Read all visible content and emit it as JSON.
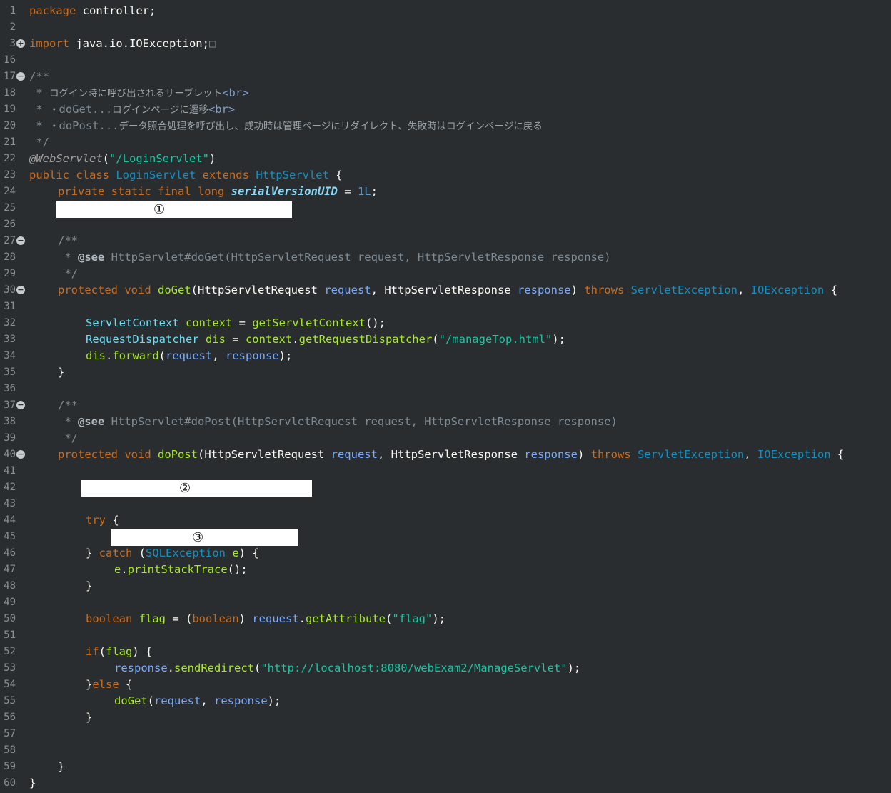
{
  "editor": {
    "language": "java",
    "lines": [
      {
        "n": "1",
        "fold": ""
      },
      {
        "n": "2",
        "fold": ""
      },
      {
        "n": "3",
        "fold": "+"
      },
      {
        "n": "16",
        "fold": ""
      },
      {
        "n": "17",
        "fold": "-"
      },
      {
        "n": "18",
        "fold": ""
      },
      {
        "n": "19",
        "fold": ""
      },
      {
        "n": "20",
        "fold": ""
      },
      {
        "n": "21",
        "fold": ""
      },
      {
        "n": "22",
        "fold": ""
      },
      {
        "n": "23",
        "fold": ""
      },
      {
        "n": "24",
        "fold": ""
      },
      {
        "n": "25",
        "fold": ""
      },
      {
        "n": "26",
        "fold": ""
      },
      {
        "n": "27",
        "fold": "-"
      },
      {
        "n": "28",
        "fold": ""
      },
      {
        "n": "29",
        "fold": ""
      },
      {
        "n": "30",
        "fold": "-"
      },
      {
        "n": "31",
        "fold": ""
      },
      {
        "n": "32",
        "fold": ""
      },
      {
        "n": "33",
        "fold": ""
      },
      {
        "n": "34",
        "fold": ""
      },
      {
        "n": "35",
        "fold": ""
      },
      {
        "n": "36",
        "fold": ""
      },
      {
        "n": "37",
        "fold": "-"
      },
      {
        "n": "38",
        "fold": ""
      },
      {
        "n": "39",
        "fold": ""
      },
      {
        "n": "40",
        "fold": "-"
      },
      {
        "n": "41",
        "fold": ""
      },
      {
        "n": "42",
        "fold": ""
      },
      {
        "n": "43",
        "fold": ""
      },
      {
        "n": "44",
        "fold": ""
      },
      {
        "n": "45",
        "fold": ""
      },
      {
        "n": "46",
        "fold": ""
      },
      {
        "n": "47",
        "fold": ""
      },
      {
        "n": "48",
        "fold": ""
      },
      {
        "n": "49",
        "fold": ""
      },
      {
        "n": "50",
        "fold": ""
      },
      {
        "n": "51",
        "fold": ""
      },
      {
        "n": "52",
        "fold": ""
      },
      {
        "n": "53",
        "fold": ""
      },
      {
        "n": "54",
        "fold": ""
      },
      {
        "n": "55",
        "fold": ""
      },
      {
        "n": "56",
        "fold": ""
      },
      {
        "n": "57",
        "fold": ""
      },
      {
        "n": "58",
        "fold": ""
      },
      {
        "n": "59",
        "fold": ""
      },
      {
        "n": "60",
        "fold": ""
      }
    ]
  },
  "code": {
    "l1": {
      "kw": "package",
      "rest": " controller;"
    },
    "l3": {
      "kw": "import",
      "rest": " java.io.IOException;",
      "collapsed": "□"
    },
    "l17": "/**",
    "l18": {
      "star": " * ",
      "jp": "ログイン時に呼び出されるサーブレット",
      "tag": "<br>"
    },
    "l19": {
      "star": " * ",
      "jp1": "・",
      "code": "doGet...",
      "jp2": "ログインページに遷移",
      "tag": "<br>"
    },
    "l20": {
      "star": " * ",
      "jp1": "・",
      "code": "doPost...",
      "jp2": "データ照合処理を呼び出し、成功時は管理ページにリダイレクト、失敗時はログインページに戻る"
    },
    "l21": " */",
    "l22": {
      "ann": "@WebServlet",
      "p1": "(",
      "str": "\"/LoginServlet\"",
      "p2": ")"
    },
    "l23": {
      "kw1": "public class ",
      "ty1": "LoginServlet",
      "kw2": " extends ",
      "ty2": "HttpServlet",
      "p": " {"
    },
    "l24": {
      "kw": "private static final long ",
      "const": "serialVersionUID",
      "eq": " = ",
      "num": "1L",
      "p": ";"
    },
    "blank1": "①",
    "l27": "/**",
    "l28": {
      "star": " * ",
      "see": "@see",
      "rest": " HttpServlet#doGet(HttpServletRequest request, HttpServletResponse response)"
    },
    "l29": " */",
    "l30": {
      "kw1": "protected void ",
      "fn": "doGet",
      "p1": "(",
      "ty1": "HttpServletRequest",
      "v1": " request",
      "c1": ", ",
      "ty2": "HttpServletResponse",
      "v2": " response",
      "p2": ") ",
      "kw2": "throws ",
      "ty3": "ServletException",
      "c2": ", ",
      "ty4": "IOException",
      "p3": " {"
    },
    "l32": {
      "ty": "ServletContext",
      "v": " context",
      "eq": " = ",
      "fn": "getServletContext",
      "p": "();"
    },
    "l33": {
      "ty": "RequestDispatcher",
      "v": " dis",
      "eq": " = ",
      "v2": "context",
      "dot": ".",
      "fn": "getRequestDispatcher",
      "p1": "(",
      "str": "\"/manageTop.html\"",
      "p2": ");"
    },
    "l34": {
      "v": "dis",
      "dot": ".",
      "fn": "forward",
      "p1": "(",
      "a1": "request",
      "c": ", ",
      "a2": "response",
      "p2": ");"
    },
    "l35": "}",
    "l37": "/**",
    "l38": {
      "star": " * ",
      "see": "@see",
      "rest": " HttpServlet#doPost(HttpServletRequest request, HttpServletResponse response)"
    },
    "l39": " */",
    "l40": {
      "kw1": "protected void ",
      "fn": "doPost",
      "p1": "(",
      "ty1": "HttpServletRequest",
      "v1": " request",
      "c1": ", ",
      "ty2": "HttpServletResponse",
      "v2": " response",
      "p2": ") ",
      "kw2": "throws ",
      "ty3": "ServletException",
      "c2": ", ",
      "ty4": "IOException",
      "p3": " {"
    },
    "blank2": "②",
    "l44": {
      "kw": "try",
      "p": " {"
    },
    "blank3": "③",
    "l46": {
      "p1": "} ",
      "kw": "catch",
      "p2": " (",
      "ty": "SQLException",
      "v": " e",
      "p3": ") {"
    },
    "l47": {
      "v": "e",
      "dot": ".",
      "fn": "printStackTrace",
      "p": "();"
    },
    "l48": "}",
    "l50": {
      "kw": "boolean",
      "v": " flag",
      "eq": " = (",
      "kw2": "boolean",
      "p1": ") ",
      "v2": "request",
      "dot": ".",
      "fn": "getAttribute",
      "p2": "(",
      "str": "\"flag\"",
      "p3": ");"
    },
    "l52": {
      "kw": "if",
      "p1": "(",
      "v": "flag",
      "p2": ") {"
    },
    "l53": {
      "v": "response",
      "dot": ".",
      "fn": "sendRedirect",
      "p1": "(",
      "str": "\"http://localhost:8080/webExam2/ManageServlet\"",
      "p2": ");"
    },
    "l54": {
      "p1": "}",
      "kw": "else",
      "p2": " {"
    },
    "l55": {
      "fn": "doGet",
      "p1": "(",
      "a1": "request",
      "c": ", ",
      "a2": "response",
      "p2": ");"
    },
    "l56": "}",
    "l59": "}",
    "l60": "}"
  },
  "colors": {
    "background": "#2a2d2f",
    "keyword": "#cc6c1d",
    "type": "#1290c3",
    "method": "#a7ec21",
    "string": "#17c6a3",
    "variable": "#79abff",
    "comment": "#7f8b94"
  }
}
